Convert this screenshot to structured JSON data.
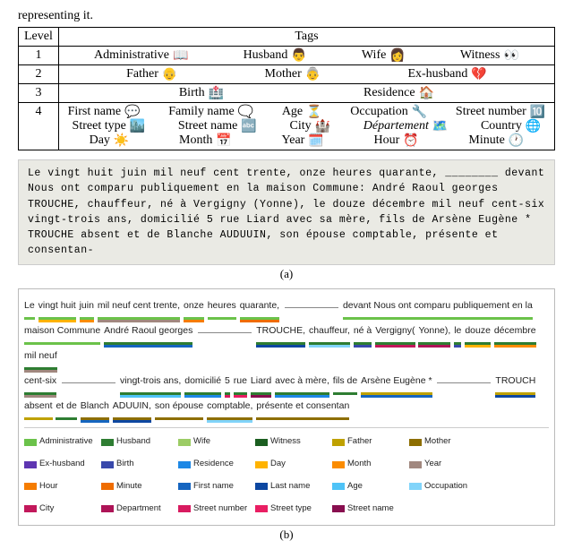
{
  "intro": "representing it.",
  "table": {
    "headers": [
      "Level",
      "Tags"
    ],
    "rows": [
      {
        "level": "1",
        "items": [
          {
            "label": "Administrative",
            "emoji": "📖"
          },
          {
            "label": "Husband",
            "emoji": "👨"
          },
          {
            "label": "Wife",
            "emoji": "👩"
          },
          {
            "label": "Witness",
            "emoji": "👀"
          }
        ]
      },
      {
        "level": "2",
        "items": [
          {
            "label": "Father",
            "emoji": "👴"
          },
          {
            "label": "Mother",
            "emoji": "👵"
          },
          {
            "label": "Ex-husband",
            "emoji": "💔"
          }
        ]
      },
      {
        "level": "3",
        "items": [
          {
            "label": "Birth",
            "emoji": "🏥"
          },
          {
            "label": "Residence",
            "emoji": "🏠"
          }
        ]
      },
      {
        "level": "4",
        "items": [
          {
            "label": "First name",
            "emoji": "💬"
          },
          {
            "label": "Family name",
            "emoji": "🗨️"
          },
          {
            "label": "Age",
            "emoji": "⏳"
          },
          {
            "label": "Occupation",
            "emoji": "🔧"
          },
          {
            "label": "Street number",
            "emoji": "🔟"
          },
          {
            "label": "Street type",
            "emoji": "🏙️"
          },
          {
            "label": "Street name",
            "emoji": "🔤"
          },
          {
            "label": "City",
            "emoji": "🏰"
          },
          {
            "label": "Département",
            "italic": true,
            "emoji": "🗺️"
          },
          {
            "label": "Country",
            "emoji": "🌐"
          },
          {
            "label": "Day",
            "emoji": "☀️"
          },
          {
            "label": "Month",
            "emoji": "📅"
          },
          {
            "label": "Year",
            "emoji": "🗓️"
          },
          {
            "label": "Hour",
            "emoji": "⏰"
          },
          {
            "label": "Minute",
            "emoji": "🕐"
          }
        ]
      }
    ]
  },
  "scan_text": "Le vingt huit juin mil neuf cent trente, onze heures quarante, ________ devant Nous ont comparu publiquement en la maison Commune: André Raoul georges TROUCHE, chauffeur, né à Vergigny (Yonne), le douze décembre mil neuf cent-six vingt-trois ans, domicilié 5 rue Liard avec sa mère, fils de Arsène Eugène * TROUCHE absent et de Blanche AUDUUIN, son épouse comptable, présente et consentan-",
  "caption_a": "(a)",
  "caption_b": "(b)",
  "annot": {
    "segments": [
      [
        "Le",
        "c-admin"
      ],
      [
        "vingt huit",
        "c-admin c-day"
      ],
      [
        "juin",
        "c-admin c-month"
      ],
      [
        "mil neuf cent trente,",
        "c-admin c-year"
      ],
      [
        "onze",
        "c-admin c-hour"
      ],
      [
        "heures",
        "c-admin"
      ],
      [
        "quarante,",
        "c-admin c-minute"
      ],
      [
        "__GAP__",
        ""
      ],
      [
        "devant Nous ont comparu publiquement en la",
        "c-admin"
      ],
      [
        "__BR__",
        ""
      ],
      [
        "maison Commune",
        "c-admin"
      ],
      [
        "André Raoul georges",
        "c-husband c-first"
      ],
      [
        "__GAP__",
        ""
      ],
      [
        "TROUCHE,",
        "c-husband c-last"
      ],
      [
        "chauffeur,",
        "c-husband c-occ"
      ],
      [
        "né à",
        "c-husband c-birth"
      ],
      [
        "Vergigny(",
        "c-husband c-city"
      ],
      [
        "Yonne),",
        "c-husband c-dept"
      ],
      [
        "le",
        "c-husband c-birth"
      ],
      [
        "douze",
        "c-husband c-day"
      ],
      [
        "décembre",
        "c-husband c-month"
      ],
      [
        "mil neuf",
        "c-husband c-year"
      ],
      [
        "__BR__",
        ""
      ],
      [
        "cent-six",
        "c-husband c-year"
      ],
      [
        "__GAP__",
        ""
      ],
      [
        "vingt-trois ans,",
        "c-husband c-age"
      ],
      [
        "domicilié",
        "c-husband c-resid"
      ],
      [
        "5",
        "c-husband c-stnum"
      ],
      [
        "rue",
        "c-husband c-sttype"
      ],
      [
        "Liard",
        "c-husband c-stname"
      ],
      [
        "avec à mère,",
        "c-husband c-resid"
      ],
      [
        "fils de",
        "c-husband"
      ],
      [
        "Arsène Eugène *",
        "c-father c-first"
      ],
      [
        "__GAP__",
        ""
      ],
      [
        "TROUCH",
        "c-father c-last"
      ],
      [
        "__BR__",
        ""
      ],
      [
        "absent",
        "c-father"
      ],
      [
        "et de",
        "c-husband"
      ],
      [
        "Blanch",
        "c-mother c-first"
      ],
      [
        "ADUUIN,",
        "c-mother c-last"
      ],
      [
        "son épouse",
        "c-mother"
      ],
      [
        "comptable,",
        "c-mother c-occ"
      ],
      [
        "présente et consentan",
        "c-mother"
      ]
    ]
  },
  "legend": [
    {
      "label": "Administrative",
      "cls": "c-admin"
    },
    {
      "label": "Husband",
      "cls": "c-husband"
    },
    {
      "label": "Wife",
      "cls": "c-wife"
    },
    {
      "label": "Witness",
      "cls": "c-witness"
    },
    {
      "label": "Father",
      "cls": "c-father"
    },
    {
      "label": "Mother",
      "cls": "c-mother"
    },
    {
      "label": "Ex-husband",
      "cls": "c-exhusb"
    },
    {
      "label": "Birth",
      "cls": "c-birth"
    },
    {
      "label": "Residence",
      "cls": "c-resid"
    },
    {
      "label": "Day",
      "cls": "c-day"
    },
    {
      "label": "Month",
      "cls": "c-month"
    },
    {
      "label": "Year",
      "cls": "c-year"
    },
    {
      "label": "Hour",
      "cls": "c-hour"
    },
    {
      "label": "Minute",
      "cls": "c-minute"
    },
    {
      "label": "First name",
      "cls": "c-first"
    },
    {
      "label": "Last name",
      "cls": "c-last"
    },
    {
      "label": "Age",
      "cls": "c-age"
    },
    {
      "label": "Occupation",
      "cls": "c-occ"
    },
    {
      "label": "City",
      "cls": "c-city"
    },
    {
      "label": "Department",
      "cls": "c-dept"
    },
    {
      "label": "Street number",
      "cls": "c-stnum"
    },
    {
      "label": "Street type",
      "cls": "c-sttype"
    },
    {
      "label": "Street name",
      "cls": "c-stname"
    }
  ]
}
